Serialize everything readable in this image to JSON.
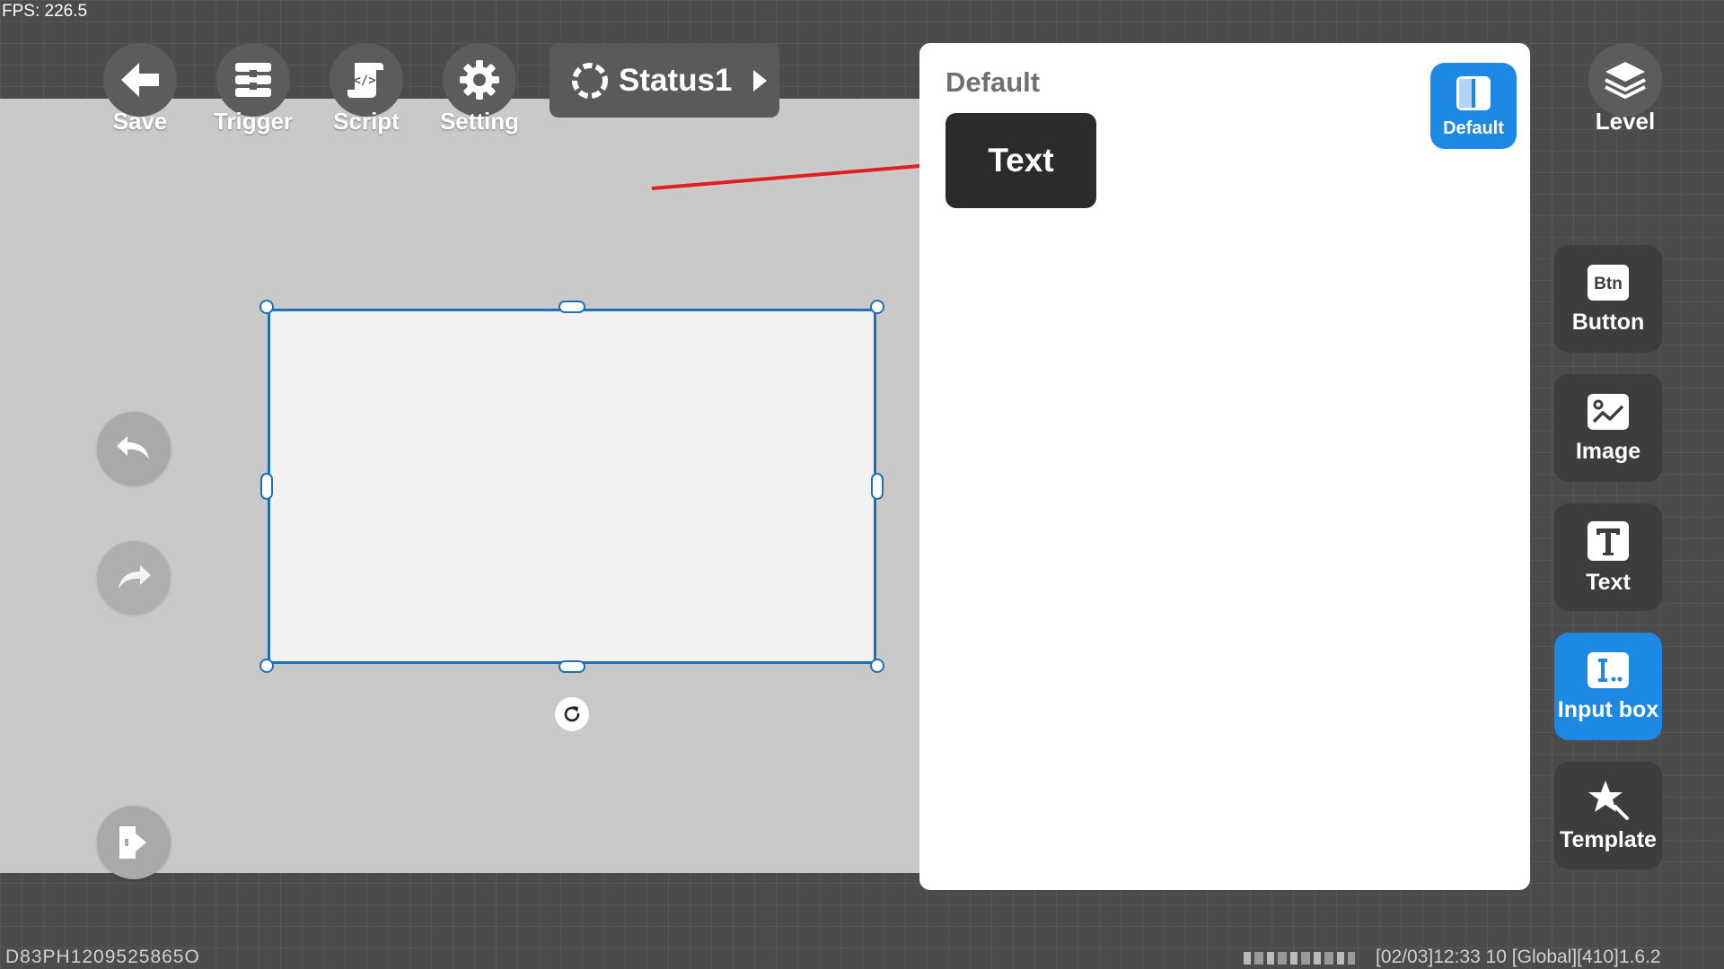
{
  "fps": "FPS: 226.5",
  "toolbar": {
    "save_label": "Save",
    "trigger_label": "Trigger",
    "script_label": "Script",
    "setting_label": "Setting",
    "status_label": "Status1"
  },
  "panel": {
    "title": "Default",
    "text_item_label": "Text",
    "default_toggle_label": "Default"
  },
  "right_bar": {
    "level_label": "Level",
    "components": [
      {
        "label": "Button",
        "icon": "btn-icon"
      },
      {
        "label": "Image",
        "icon": "image-icon"
      },
      {
        "label": "Text",
        "icon": "text-icon"
      },
      {
        "label": "Input box",
        "icon": "input-box-icon",
        "active": true
      },
      {
        "label": "Template",
        "icon": "template-icon"
      }
    ]
  },
  "footer": {
    "device_id": "D83PH1209525865O",
    "build_info": "[02/03]12:33 10  [Global][410]1.6.2"
  },
  "colors": {
    "accent": "#1e88e5",
    "selection": "#1f6fb6",
    "annotation_arrow": "#e02020"
  }
}
